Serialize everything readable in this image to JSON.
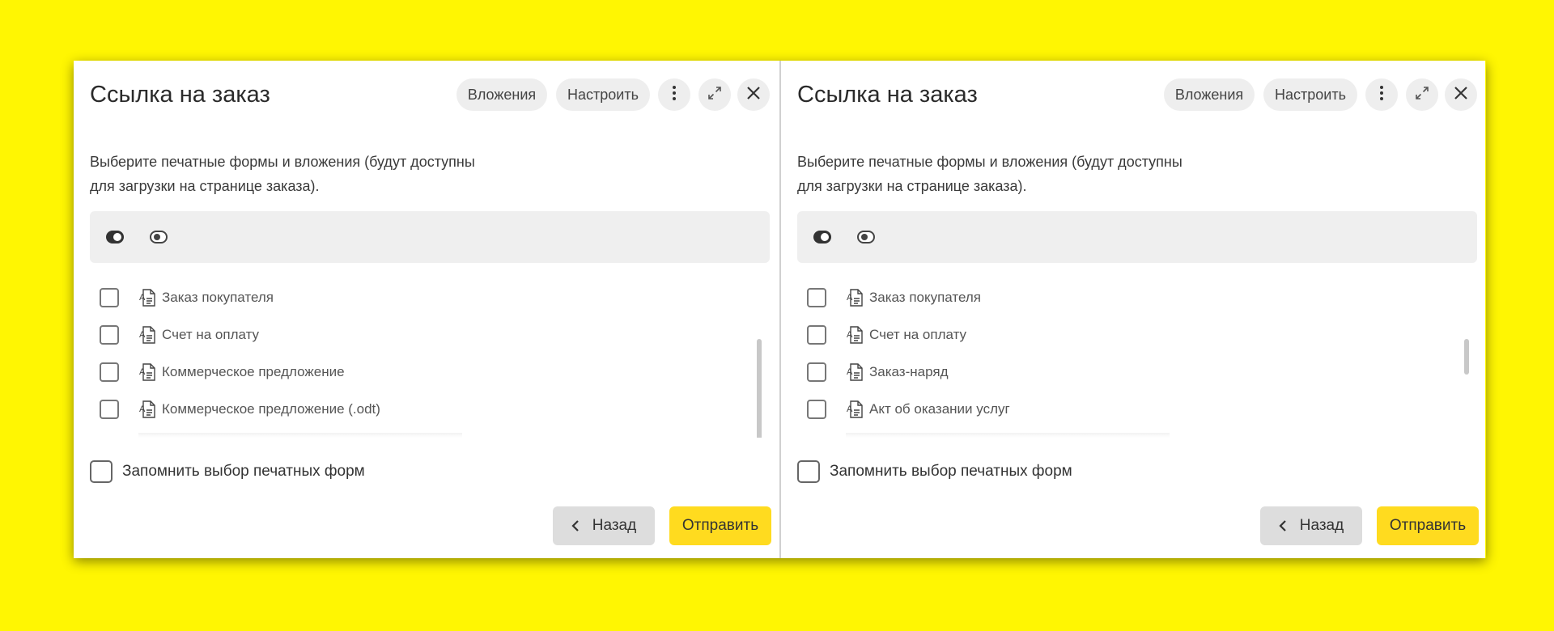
{
  "dialogs": [
    {
      "title": "Ссылка на заказ",
      "attachments_label": "Вложения",
      "setup_label": "Настроить",
      "description_line1": "Выберите печатные формы и вложения (будут доступны",
      "description_line2": "для загрузки на странице заказа).",
      "items": [
        {
          "label": "Заказ покупателя",
          "checked": false
        },
        {
          "label": "Счет на оплату",
          "checked": false
        },
        {
          "label": "Коммерческое предложение",
          "checked": false
        },
        {
          "label": "Коммерческое предложение (.odt)",
          "checked": false
        }
      ],
      "remember_label": "Запомнить выбор печатных форм",
      "back_label": "Назад",
      "send_label": "Отправить"
    },
    {
      "title": "Ссылка на заказ",
      "attachments_label": "Вложения",
      "setup_label": "Настроить",
      "description_line1": "Выберите печатные формы и вложения (будут доступны",
      "description_line2": "для загрузки на странице заказа).",
      "items": [
        {
          "label": "Заказ покупателя",
          "checked": false
        },
        {
          "label": "Счет на оплату",
          "checked": false
        },
        {
          "label": "Заказ-наряд",
          "checked": false
        },
        {
          "label": "Акт об оказании услуг",
          "checked": false
        }
      ],
      "remember_label": "Запомнить выбор печатных форм",
      "back_label": "Назад",
      "send_label": "Отправить"
    }
  ],
  "icons": {
    "more": "more-vertical-icon",
    "expand": "expand-icon",
    "close": "close-icon",
    "toggle_all_on": "toggle-on-icon",
    "toggle_all_off": "toggle-off-icon",
    "item": "document-template-icon",
    "back": "chevron-left-icon"
  },
  "colors": {
    "background": "#fff602",
    "send_button": "#ffdb1f",
    "back_button": "#dddddd",
    "header_button": "#eeeeee"
  }
}
